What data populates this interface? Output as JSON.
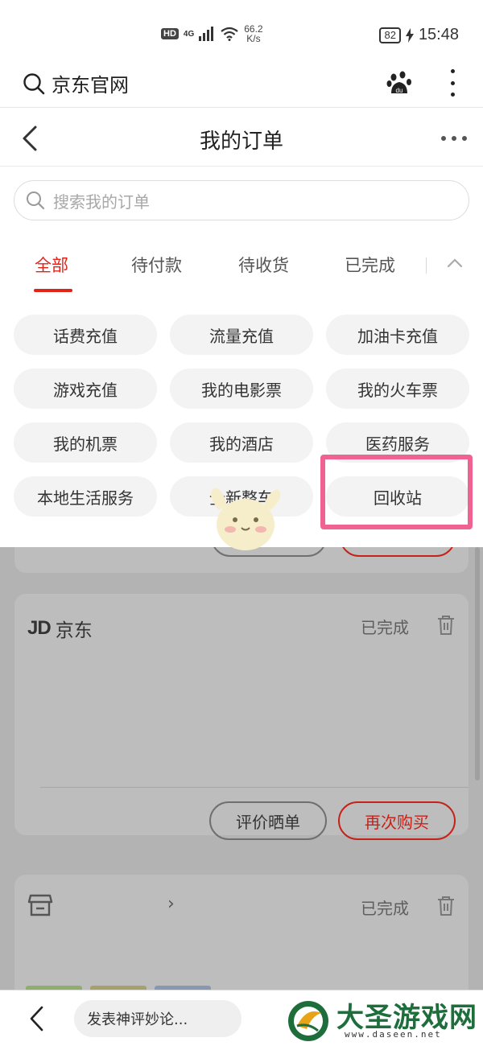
{
  "status_bar": {
    "hd": "HD",
    "network": "4G",
    "speed_value": "66.2",
    "speed_unit": "K/s",
    "battery": "82",
    "time": "15:48"
  },
  "browser": {
    "title": "京东官网"
  },
  "header": {
    "title": "我的订单"
  },
  "search": {
    "placeholder": "搜索我的订单"
  },
  "tabs": [
    {
      "label": "全部",
      "active": true
    },
    {
      "label": "待付款",
      "active": false
    },
    {
      "label": "待收货",
      "active": false
    },
    {
      "label": "已完成",
      "active": false
    }
  ],
  "categories": [
    "话费充值",
    "流量充值",
    "加油卡充值",
    "游戏充值",
    "我的电影票",
    "我的火车票",
    "我的机票",
    "我的酒店",
    "医药服务",
    "本地生活服务",
    "全新整车",
    "回收站"
  ],
  "orders": [
    {
      "shop": "京东",
      "shop_logo": "JD",
      "status": "已完成",
      "buttons": [
        "评价晒单",
        "再次购买"
      ]
    },
    {
      "shop": "",
      "status": "已完成"
    }
  ],
  "bottom": {
    "comment_placeholder": "发表神评妙论...",
    "watermark_title": "大圣游戏网",
    "watermark_url": "www.daseen.net"
  },
  "colors": {
    "accent": "#e2231a",
    "highlight": "#f06292",
    "watermark": "#1d6e3b"
  }
}
